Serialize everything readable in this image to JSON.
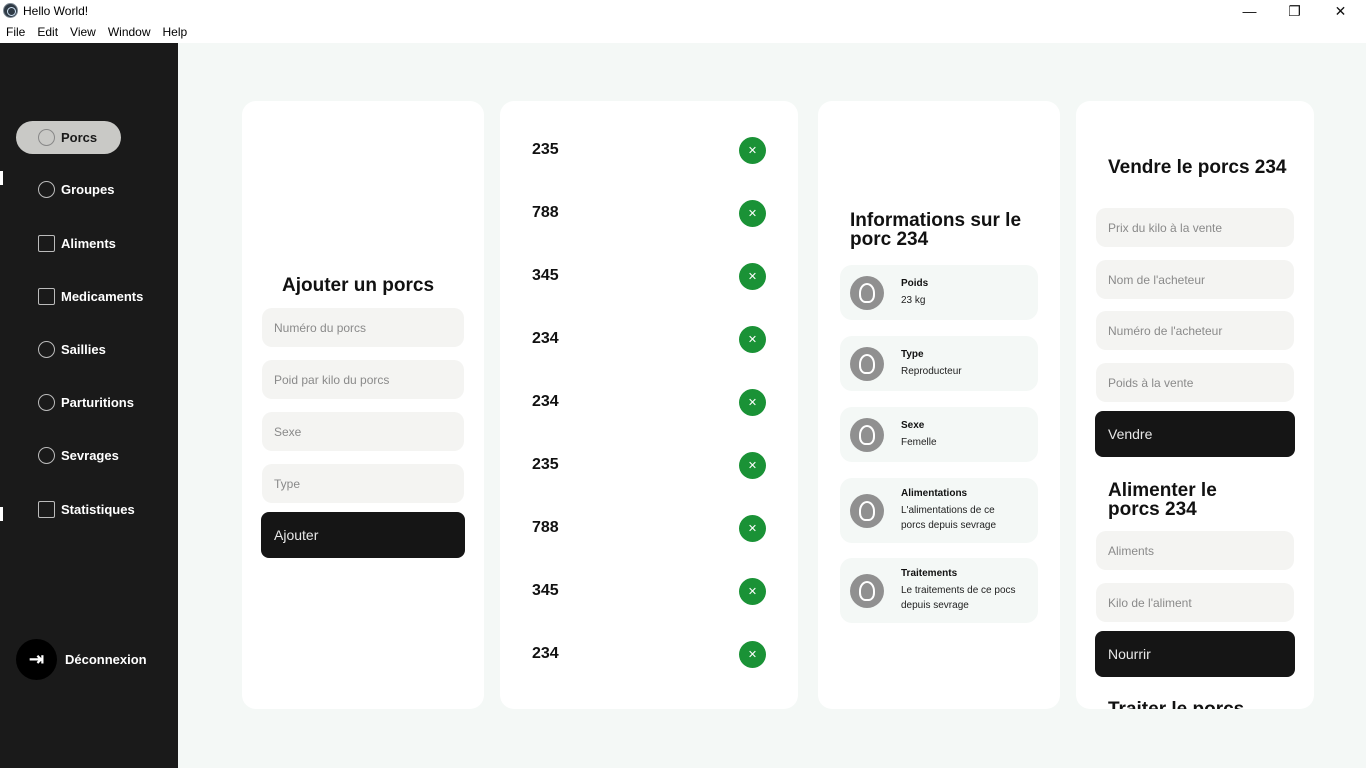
{
  "window": {
    "title": "Hello World!",
    "minimize": "—",
    "maximize": "❐",
    "close": "✕"
  },
  "menu": [
    "File",
    "Edit",
    "View",
    "Window",
    "Help"
  ],
  "sidebar": {
    "items": [
      {
        "label": "Porcs",
        "icon": "gauge-icon"
      },
      {
        "label": "Groupes",
        "icon": "alarm-clock-icon"
      },
      {
        "label": "Aliments",
        "icon": "fridge-icon"
      },
      {
        "label": "Medicaments",
        "icon": "receipt-icon"
      },
      {
        "label": "Saillies",
        "icon": "gauge-icon"
      },
      {
        "label": "Parturitions",
        "icon": "alarm-clock-icon"
      },
      {
        "label": "Sevrages",
        "icon": "gauge-icon"
      },
      {
        "label": "Statistiques",
        "icon": "receipt-icon"
      }
    ],
    "logout": {
      "label": "Déconnexion",
      "icon": "logout-icon",
      "glyph": "⇥"
    }
  },
  "add_card": {
    "title": "Ajouter un porcs",
    "fields": [
      "Numéro du porcs",
      "Poid par kilo du porcs",
      "Sexe",
      "Type"
    ],
    "button": "Ajouter"
  },
  "list_card": {
    "rows": [
      "235",
      "788",
      "345",
      "234",
      "234",
      "235",
      "788",
      "345",
      "234"
    ],
    "remove_glyph": "✕"
  },
  "info_card": {
    "title": "Informations sur le porc 234",
    "items": [
      {
        "label": "Poids",
        "value": "23 kg"
      },
      {
        "label": "Type",
        "value": "Reproducteur"
      },
      {
        "label": "Sexe",
        "value": "Femelle"
      },
      {
        "label": "Alimentations",
        "value": "L'alimentations de ce porcs depuis sevrage"
      },
      {
        "label": "Traitements",
        "value": "Le traitements de ce pocs depuis sevrage"
      }
    ]
  },
  "sell_card": {
    "sell_title": "Vendre le porcs 234",
    "sell_fields": [
      "Prix du kilo à la vente",
      "Nom de l'acheteur",
      "Numéro de l'acheteur",
      "Poids à la vente"
    ],
    "sell_button": "Vendre",
    "feed_title": "Alimenter le porcs 234",
    "feed_fields": [
      "Aliments",
      "Kilo de l'aliment"
    ],
    "feed_button": "Nourrir",
    "treat_title": "Traiter le porcs"
  }
}
